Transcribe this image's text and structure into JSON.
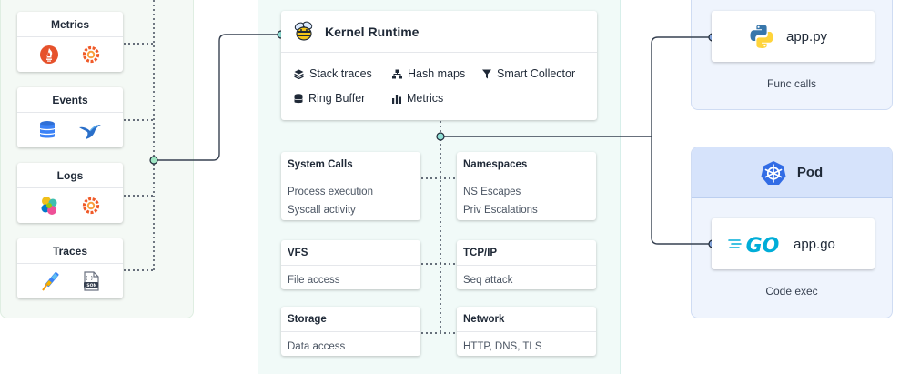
{
  "sources": [
    {
      "label": "Metrics",
      "icons": [
        "prometheus-icon",
        "grafana-icon"
      ]
    },
    {
      "label": "Events",
      "icons": [
        "database-icon",
        "bird-icon"
      ]
    },
    {
      "label": "Logs",
      "icons": [
        "elastic-icon",
        "grafana-icon"
      ]
    },
    {
      "label": "Traces",
      "icons": [
        "telescope-icon",
        "json-file-icon"
      ]
    }
  ],
  "kernel": {
    "title": "Kernel Runtime",
    "icon": "bee-icon",
    "features": [
      {
        "label": "Stack traces",
        "icon": "stack-icon"
      },
      {
        "label": "Hash maps",
        "icon": "hierarchy-icon"
      },
      {
        "label": "Smart Collector",
        "icon": "funnel-icon"
      },
      {
        "label": "Ring Buffer",
        "icon": "database-icon"
      },
      {
        "label": "Metrics",
        "icon": "bar-chart-icon"
      }
    ]
  },
  "probes": [
    {
      "title": "System Calls",
      "lines": [
        "Process execution",
        "Syscall activity"
      ]
    },
    {
      "title": "Namespaces",
      "lines": [
        "NS Escapes",
        "Priv Escalations"
      ]
    },
    {
      "title": "VFS",
      "lines": [
        "File access"
      ]
    },
    {
      "title": "TCP/IP",
      "lines": [
        "Seq attack"
      ]
    },
    {
      "title": "Storage",
      "lines": [
        "Data access"
      ]
    },
    {
      "title": "Network",
      "lines": [
        "HTTP, DNS, TLS"
      ]
    }
  ],
  "apps": {
    "python": {
      "label": "app.py",
      "caption": "Func calls",
      "icon": "python-icon"
    },
    "pod": {
      "title": "Pod",
      "icon": "kubernetes-icon"
    },
    "go": {
      "label": "app.go",
      "caption": "Code exec",
      "icon": "go-logo-icon",
      "logo_text": "GO"
    }
  },
  "colors": {
    "left_panel_bg": "#f4f9f5",
    "center_panel_bg": "#f1faf8",
    "right_panel_bg": "#eff4fd",
    "pod_header_bg": "#d6e3fb",
    "connector_green": "#3aa57a",
    "connector_blue": "#5b7fc4",
    "line_dark": "#374151"
  }
}
